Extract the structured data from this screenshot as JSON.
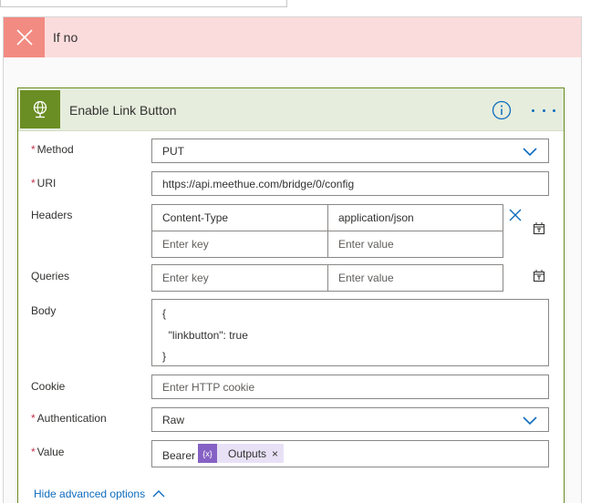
{
  "branch": {
    "title": "If no"
  },
  "action": {
    "title": "Enable Link Button"
  },
  "fields": {
    "method": {
      "label": "Method",
      "value": "PUT"
    },
    "uri": {
      "label": "URI",
      "value": "https://api.meethue.com/bridge/0/config"
    },
    "headers": {
      "label": "Headers",
      "rows": [
        {
          "key": "Content-Type",
          "value": "application/json"
        }
      ],
      "key_placeholder": "Enter key",
      "value_placeholder": "Enter value"
    },
    "queries": {
      "label": "Queries",
      "key_placeholder": "Enter key",
      "value_placeholder": "Enter value"
    },
    "body": {
      "label": "Body",
      "lines": [
        "{",
        "  \"linkbutton\": true",
        "}"
      ]
    },
    "cookie": {
      "label": "Cookie",
      "placeholder": "Enter HTTP cookie"
    },
    "authentication": {
      "label": "Authentication",
      "value": "Raw"
    },
    "value": {
      "label": "Value",
      "prefix": "Bearer",
      "token_icon": "{x}",
      "token_label": "Outputs",
      "token_remove": "×"
    }
  },
  "hide_advanced": "Hide advanced options",
  "colors": {
    "branch_header_bg": "#fbdcdc",
    "branch_icon_bg": "#f28b82",
    "action_accent": "#6a8e23",
    "action_header_bg": "#e6eddd",
    "link_blue": "#0f6cbd",
    "token_purple": "#8661c5",
    "required_red": "#c4314b"
  },
  "icons": {
    "branch": "close-icon",
    "action": "globe-icon",
    "info": "info-icon",
    "more": "more-options-icon",
    "dropdown": "chevron-down-icon",
    "remove_header": "close-icon",
    "switch_mode": "text-mode-icon",
    "collapse": "chevron-up-icon"
  }
}
